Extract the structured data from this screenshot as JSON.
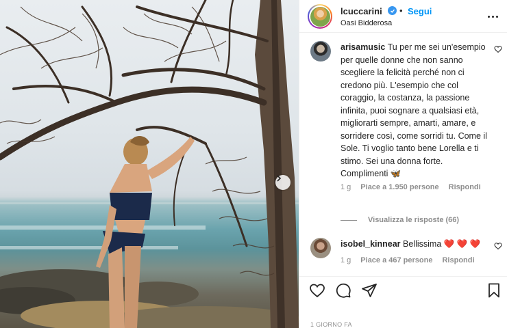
{
  "post": {
    "username": "lcuccarini",
    "follow_label": "Segui",
    "separator": "•",
    "location": "Oasi Bidderosa"
  },
  "comments": [
    {
      "user": "arisamusic",
      "text": "Tu per me sei un'esempio per quelle donne che non sanno scegliere la felicità perché non ci credono più. L'esempio che col coraggio, la costanza, la passione infinita, puoi sognare a qualsiasi età, migliorarti sempre, amarti, amare, e sorridere così, come sorridi tu. Come il Sole. Ti voglio tanto bene Lorella e ti stimo. Sei una donna forte. Complimenti 🦋",
      "age": "1 g",
      "likes": "Piace a 1.950 persone",
      "reply": "Rispondi"
    },
    {
      "user": "isobel_kinnear",
      "text": "Bellissima ❤️ ❤️ ❤️",
      "age": "1 g",
      "likes": "Piace a 467 persone",
      "reply": "Rispondi"
    }
  ],
  "view_replies": "Visualizza le risposte (66)",
  "timestamp": "1 GIORNO FA",
  "icons": [
    "verified-badge-icon",
    "more-options-icon",
    "heart-icon",
    "comment-icon",
    "share-icon",
    "bookmark-icon",
    "chevron-right-icon"
  ],
  "colors": {
    "accent": "#0095f6",
    "text": "#262626",
    "muted": "#8e8e8e"
  }
}
